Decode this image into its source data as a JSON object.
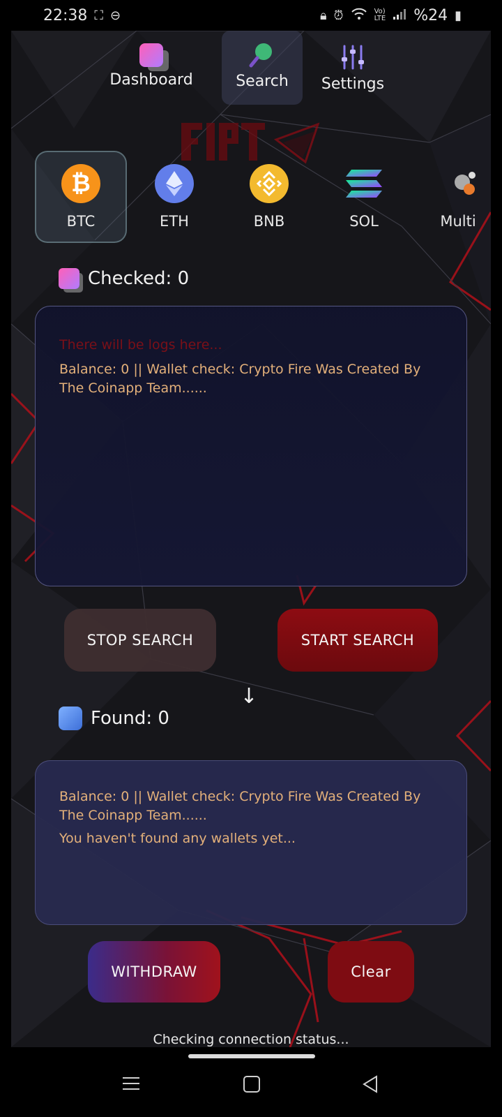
{
  "status_bar": {
    "time": "22:38",
    "battery": "%24",
    "icons": [
      "screenshot-icon",
      "dnd-icon",
      "lock-icon",
      "alarm-icon",
      "wifi-icon",
      "volte-icon",
      "signal-icon",
      "battery-icon"
    ]
  },
  "nav": {
    "tabs": [
      {
        "label": "Dashboard",
        "icon": "dashboard-icon"
      },
      {
        "label": "Search",
        "icon": "search-icon",
        "active": true
      },
      {
        "label": "Settings",
        "icon": "sliders-icon"
      }
    ]
  },
  "coins": [
    {
      "label": "BTC",
      "icon": "bitcoin-icon",
      "symbol": "₿",
      "color": "#F7931A",
      "active": true
    },
    {
      "label": "ETH",
      "icon": "ethereum-icon",
      "symbol": "♦",
      "color": "#627EEA"
    },
    {
      "label": "BNB",
      "icon": "bnb-icon",
      "symbol": "◈",
      "color": "#F3BA2F"
    },
    {
      "label": "SOL",
      "icon": "solana-icon",
      "symbol": "≡",
      "color": "#14F195"
    },
    {
      "label": "Multi",
      "icon": "multi-coin-icon",
      "symbol": "",
      "color": "#888888"
    }
  ],
  "checked": {
    "label": "Checked: 0"
  },
  "log": {
    "placeholder": "There will be logs here...",
    "entry": "Balance: 0 || Wallet check: Crypto Fire Was Created By The Coinapp Team......"
  },
  "buttons": {
    "stop": "STOP SEARCH",
    "start": "START SEARCH",
    "withdraw": "WITHDRAW",
    "clear": "Clear"
  },
  "found": {
    "label": "Found: 0",
    "entry": "Balance: 0 || Wallet check: Crypto Fire Was Created By The Coinapp Team......",
    "empty_message": "You haven't found any wallets yet..."
  },
  "connection_status": "Checking connection status...",
  "colors": {
    "accent_red": "#8d0c12",
    "log_text": "#e3b07a",
    "placeholder": "#7a1018"
  }
}
